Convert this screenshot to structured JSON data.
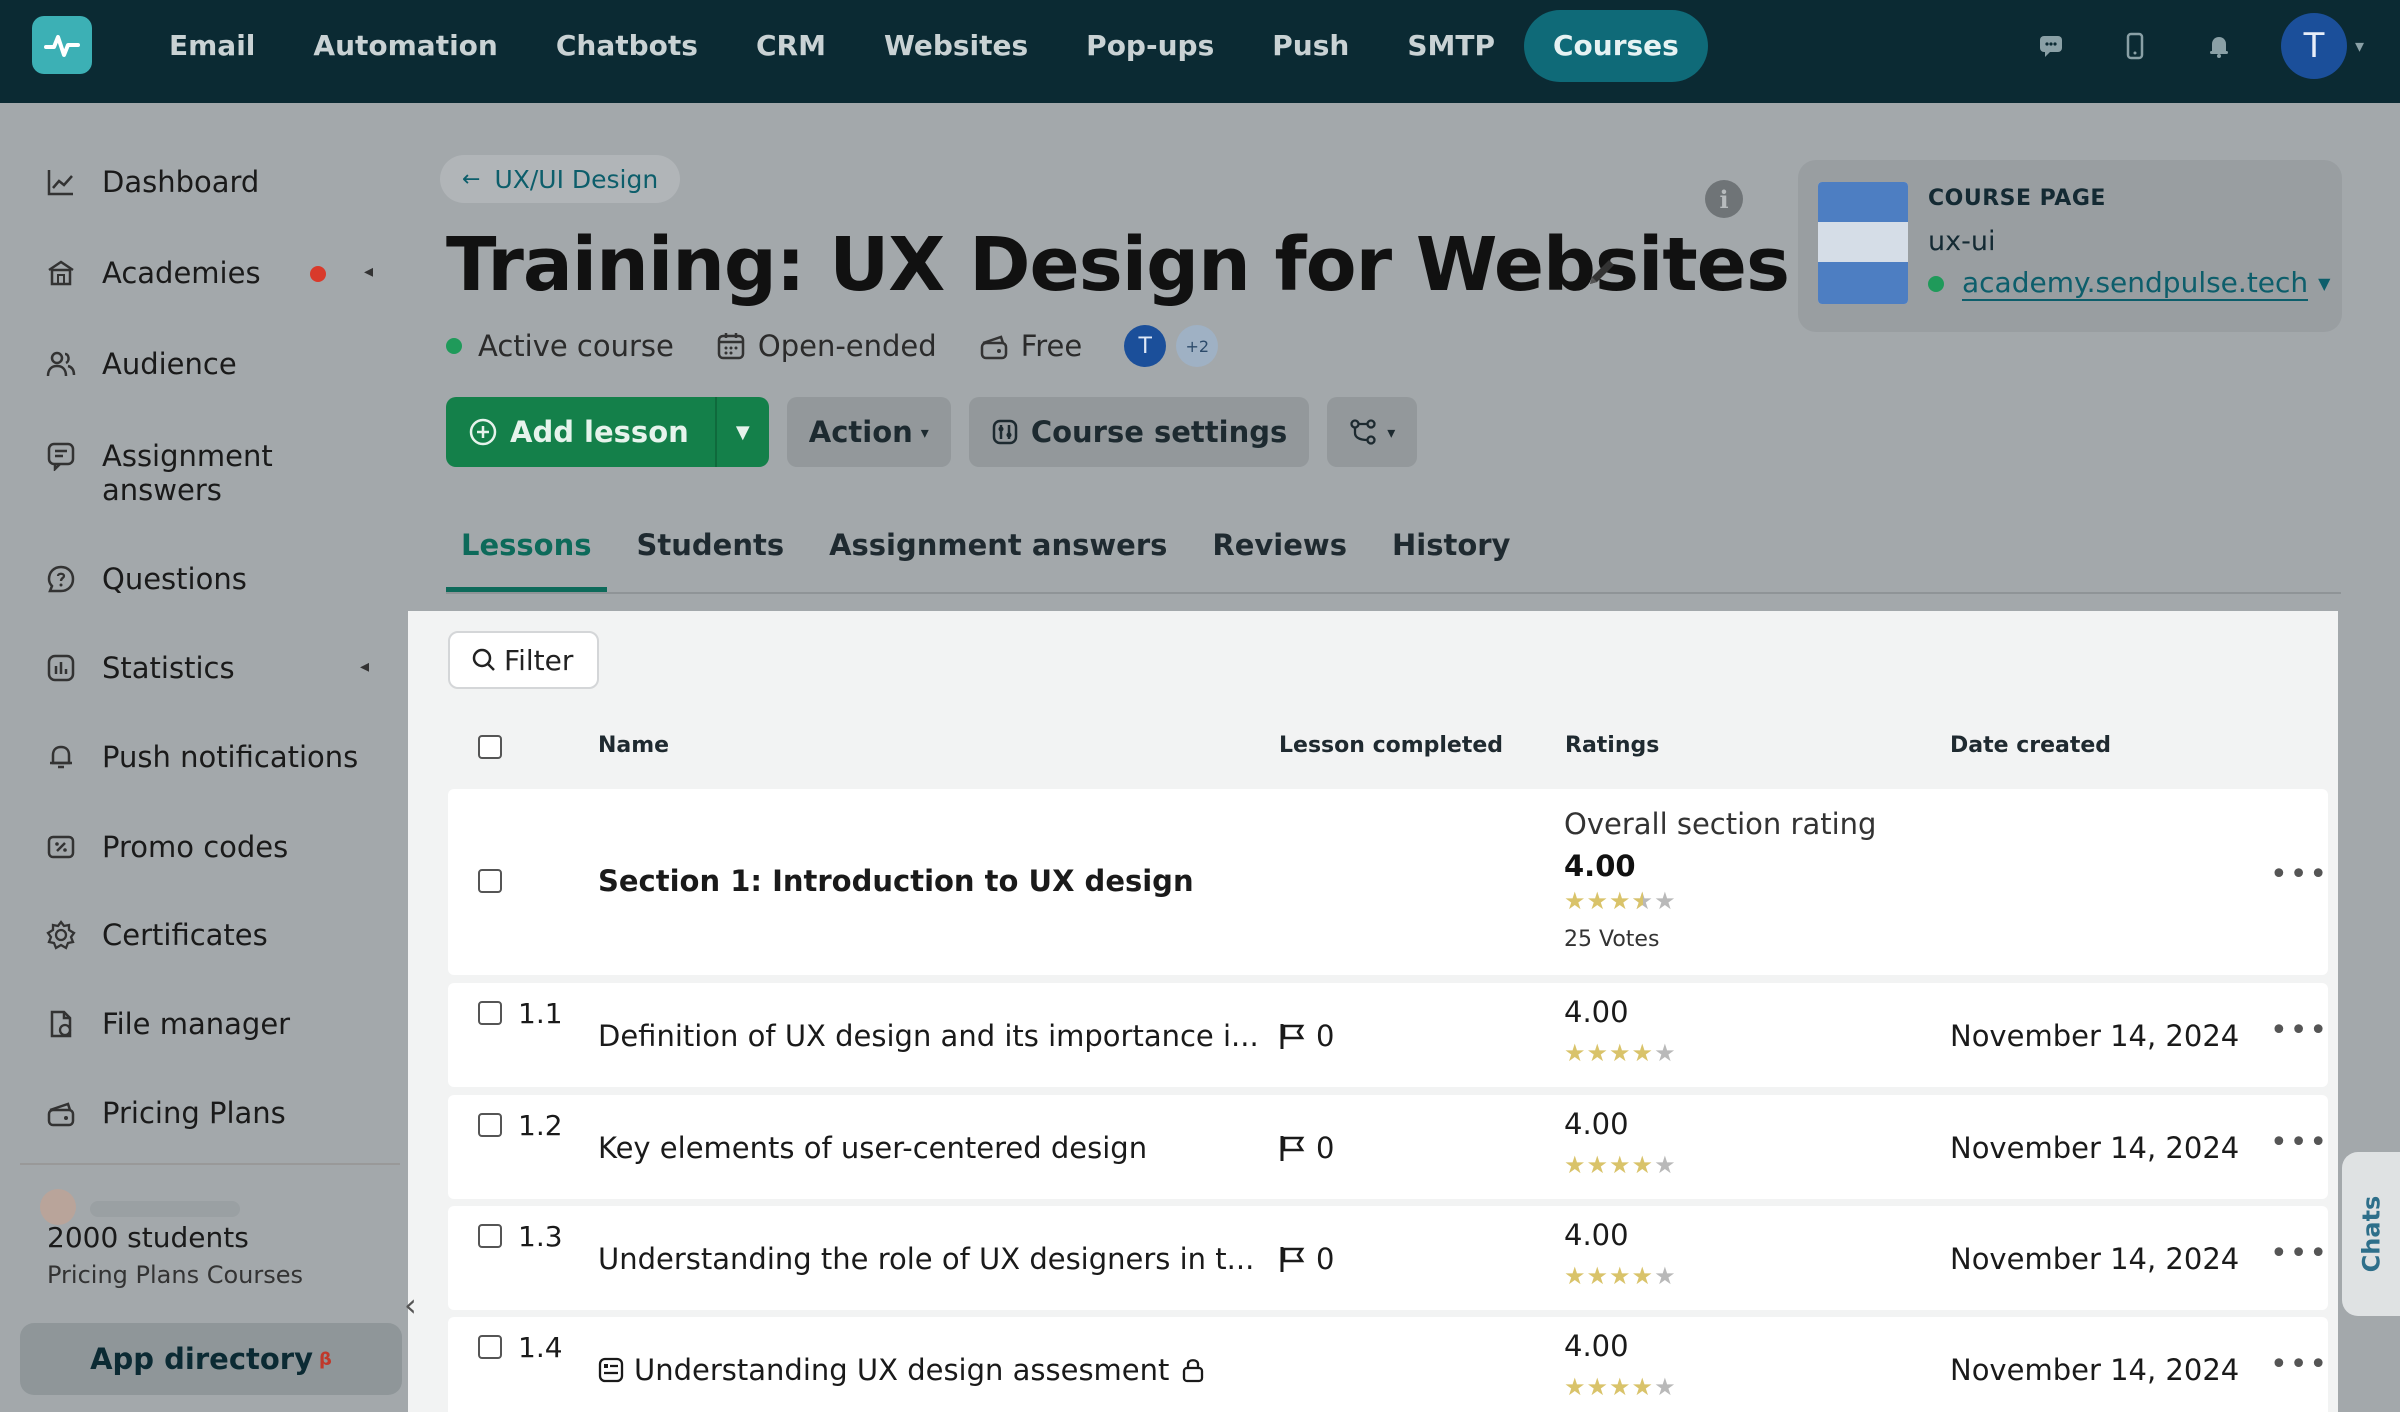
{
  "nav": {
    "items": [
      "Email",
      "Automation",
      "Chatbots",
      "CRM",
      "Websites",
      "Pop-ups",
      "Push",
      "SMTP",
      "Courses"
    ],
    "active": "Courses",
    "avatar_initial": "T",
    "icons": [
      "chat-icon",
      "mobile-icon",
      "bell-icon"
    ]
  },
  "sidebar": {
    "items": [
      {
        "label": "Dashboard",
        "icon": "chart-line-icon"
      },
      {
        "label": "Academies",
        "icon": "academy-icon"
      },
      {
        "label": "Audience",
        "icon": "users-icon"
      },
      {
        "label": "Assignment answers",
        "icon": "assignment-icon"
      },
      {
        "label": "Questions",
        "icon": "question-icon"
      },
      {
        "label": "Statistics",
        "icon": "statistics-icon"
      },
      {
        "label": "Push notifications",
        "icon": "bell-icon"
      },
      {
        "label": "Promo codes",
        "icon": "promo-icon"
      },
      {
        "label": "Certificates",
        "icon": "certificate-icon"
      },
      {
        "label": "File manager",
        "icon": "file-icon"
      },
      {
        "label": "Pricing Plans",
        "icon": "wallet-icon"
      }
    ],
    "students_count": "2000 students",
    "students_plan": "Pricing Plans Courses",
    "app_directory": "App directory",
    "app_directory_badge": "β"
  },
  "header": {
    "breadcrumb": "UX/UI Design",
    "title": "Training: UX Design for Websites",
    "status": "Active course",
    "duration": "Open-ended",
    "price": "Free",
    "avatar_initial": "T",
    "extra_members": "+2"
  },
  "actions": {
    "add_lesson": "Add lesson",
    "action": "Action",
    "course_settings": "Course settings"
  },
  "tabs": [
    "Lessons",
    "Students",
    "Assignment answers",
    "Reviews",
    "History"
  ],
  "course_page": {
    "kicker": "COURSE PAGE",
    "slug": "ux-ui",
    "url": "academy.sendpulse.tech"
  },
  "filter_label": "Filter",
  "table": {
    "columns": [
      "Name",
      "Lesson completed",
      "Ratings",
      "Date created"
    ],
    "section": {
      "name": "Section 1: Introduction to UX design",
      "rating_label": "Overall section rating",
      "rating": "4.00",
      "rating_value": 3.5,
      "votes": "25 Votes"
    },
    "rows": [
      {
        "num": "1.1",
        "name": "Definition of UX design and its importance i...",
        "completed": "0",
        "rating": "4.00",
        "stars": 4,
        "date": "November 14, 2024"
      },
      {
        "num": "1.2",
        "name": "Key elements of user-centered design",
        "completed": "0",
        "rating": "4.00",
        "stars": 4,
        "date": "November 14, 2024"
      },
      {
        "num": "1.3",
        "name": "Understanding the role of UX designers in t...",
        "completed": "0",
        "rating": "4.00",
        "stars": 4,
        "date": "November 14, 2024"
      },
      {
        "num": "1.4",
        "name": "Understanding UX design assesment",
        "completed": "",
        "rating": "4.00",
        "stars": 4,
        "date": "November 14, 2024"
      }
    ]
  },
  "chats_label": "Chats"
}
